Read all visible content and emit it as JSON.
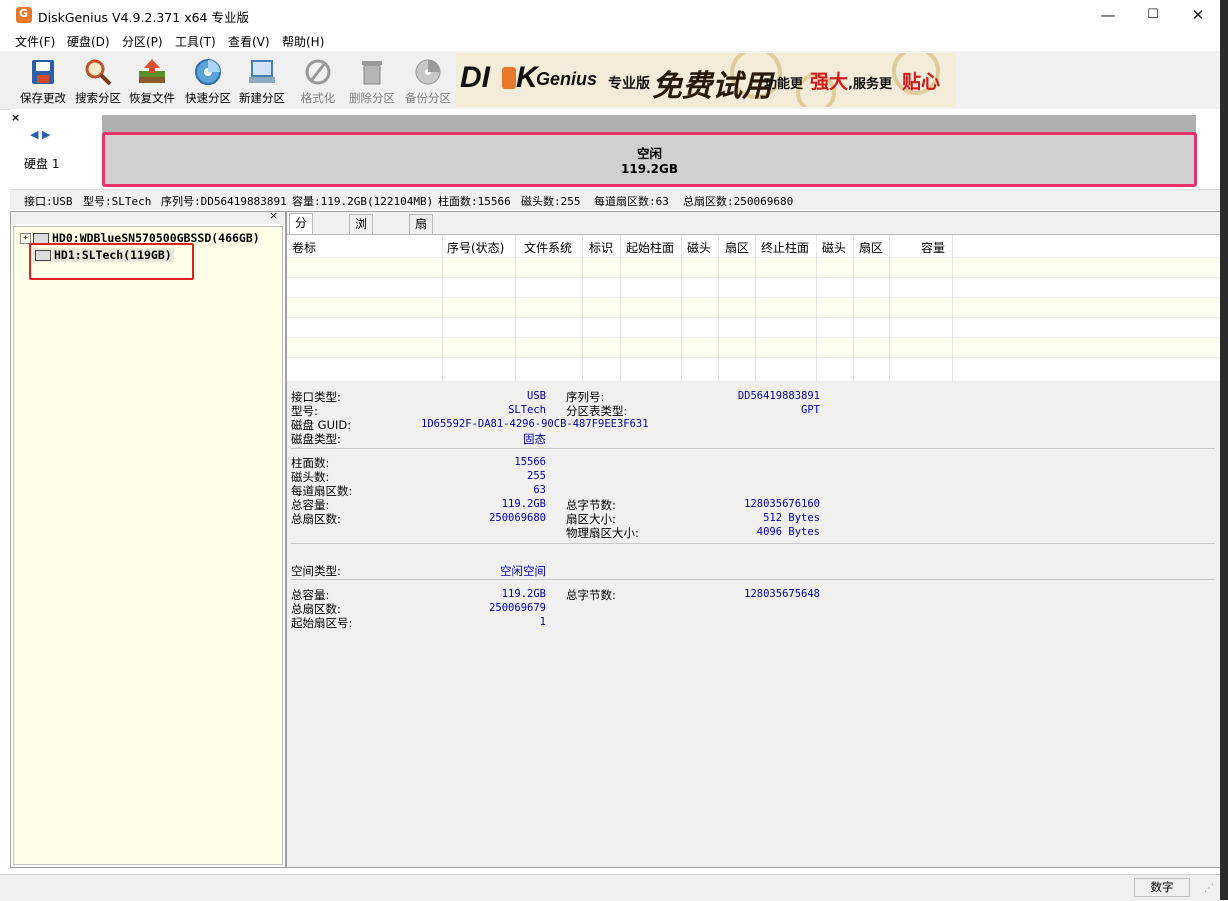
{
  "window": {
    "title": "DiskGenius V4.9.2.371 x64 专业版",
    "minimize": "—",
    "maximize": "☐",
    "close": "✕"
  },
  "menu": [
    "文件(F)",
    "硬盘(D)",
    "分区(P)",
    "工具(T)",
    "查看(V)",
    "帮助(H)"
  ],
  "toolbar": [
    {
      "label": "保存更改",
      "icon": "save-icon",
      "enabled": true
    },
    {
      "label": "搜索分区",
      "icon": "search-icon",
      "enabled": true
    },
    {
      "label": "恢复文件",
      "icon": "recover-icon",
      "enabled": true
    },
    {
      "label": "快速分区",
      "icon": "quick-partition-icon",
      "enabled": true
    },
    {
      "label": "新建分区",
      "icon": "new-partition-icon",
      "enabled": true
    },
    {
      "label": "格式化",
      "icon": "format-icon",
      "enabled": false
    },
    {
      "label": "删除分区",
      "icon": "delete-icon",
      "enabled": false
    },
    {
      "label": "备份分区",
      "icon": "backup-icon",
      "enabled": false
    }
  ],
  "banner": {
    "logo1": "DI",
    "logo2": "K",
    "logo3": "Genius",
    "edition": "专业版",
    "slogan": "免费试用",
    "tag1": "功能更",
    "tag2": "强大",
    "tag3": ",服务更",
    "tag4": "贴心"
  },
  "disk_map": {
    "close": "×",
    "nav": "◀ ▶",
    "disk_label": "硬盘 1",
    "free_label": "空闲",
    "free_size": "119.2GB"
  },
  "infobar": {
    "interface": "接口:USB",
    "model": "型号:SLTech",
    "serial": "序列号:DD56419883891",
    "capacity": "容量:119.2GB(122104MB)",
    "cylinders": "柱面数:15566",
    "heads": "磁头数:255",
    "sectors_per_track": "每道扇区数:63",
    "total_sectors": "总扇区数:250069680"
  },
  "tree": {
    "nodes": [
      {
        "label": "HD0:WDBlueSN570500GBSSD(466GB)",
        "expander": "+"
      },
      {
        "label": "HD1:SLTech(119GB)",
        "expander": ""
      }
    ]
  },
  "tabs": [
    "分区参数",
    "浏览文件",
    "扇区编辑"
  ],
  "partition_table": {
    "columns": [
      "卷标",
      "序号(状态)",
      "文件系统",
      "标识",
      "起始柱面",
      "磁头",
      "扇区",
      "终止柱面",
      "磁头",
      "扇区",
      "容量"
    ]
  },
  "details": {
    "interface_k": "接口类型:",
    "interface_v": "USB",
    "model_k": "型号:",
    "model_v": "SLTech",
    "guid_k": "磁盘 GUID:",
    "guid_v": "1D65592F-DA81-4296-90CB-487F9EE3F631",
    "disktype_k": "磁盘类型:",
    "disktype_v": "固态",
    "serial_k": "序列号:",
    "serial_v": "DD56419883891",
    "pttype_k": "分区表类型:",
    "pttype_v": "GPT",
    "cyl_k": "柱面数:",
    "cyl_v": "15566",
    "heads_k": "磁头数:",
    "heads_v": "255",
    "spt_k": "每道扇区数:",
    "spt_v": "63",
    "cap_k": "总容量:",
    "cap_v": "119.2GB",
    "totsec_k": "总扇区数:",
    "totsec_v": "250069680",
    "bytes_k": "总字节数:",
    "bytes_v": "128035676160",
    "secsize_k": "扇区大小:",
    "secsize_v": "512 Bytes",
    "physec_k": "物理扇区大小:",
    "physec_v": "4096 Bytes",
    "spacetype_k": "空间类型:",
    "spacetype_v": "空闲空间",
    "fcap_k": "总容量:",
    "fcap_v": "119.2GB",
    "fbytes_k": "总字节数:",
    "fbytes_v": "128035675648",
    "ftotsec_k": "总扇区数:",
    "ftotsec_v": "250069679",
    "fstart_k": "起始扇区号:",
    "fstart_v": "1"
  },
  "status": {
    "numlock": "数字"
  }
}
